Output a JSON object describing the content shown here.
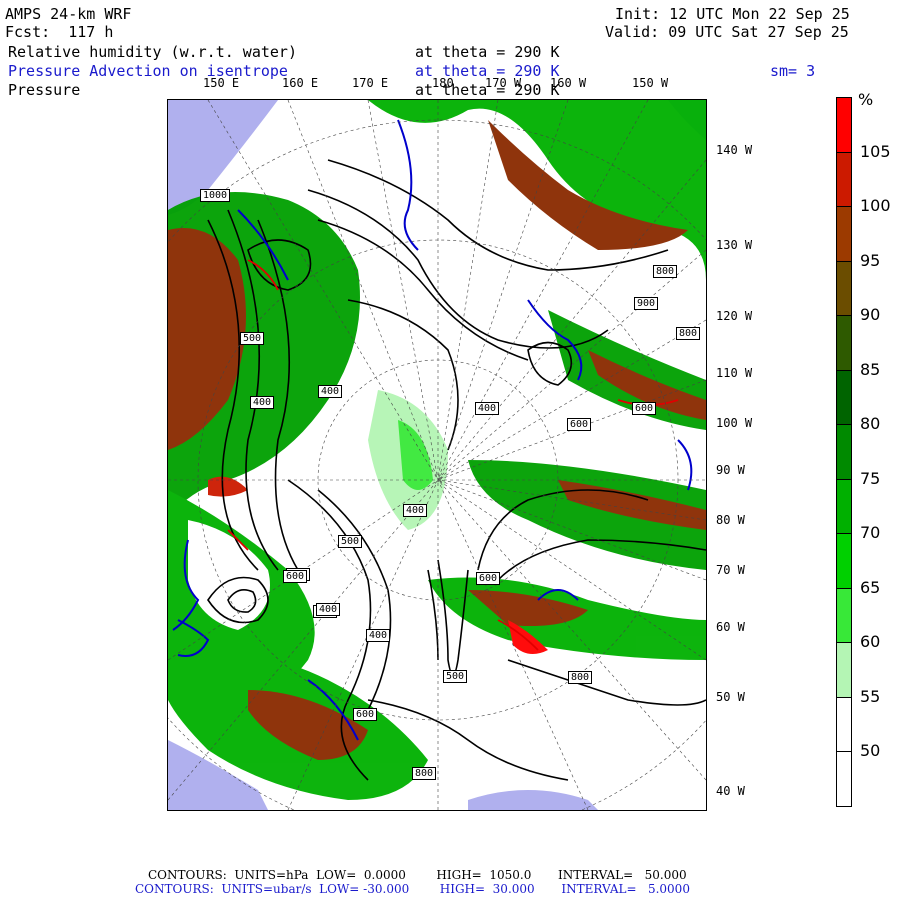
{
  "header": {
    "model": "AMPS 24-km WRF",
    "fcst": "Fcst:  117 h",
    "init": "Init: 12 UTC Mon 22 Sep 25",
    "valid": "Valid: 09 UTC Sat 27 Sep 25",
    "field1": "Relative humidity (w.r.t. water)",
    "field1_level": "at theta = 290 K",
    "field2": "Pressure Advection on isentrope",
    "field2_level": "at theta = 290 K",
    "field2_smooth": "sm= 3",
    "field3": "Pressure",
    "field3_level": "at theta = 290 K"
  },
  "lon_labels_top": [
    "150 E",
    "160 E",
    "170 E",
    "180",
    "170 W",
    "160 W",
    "150 W"
  ],
  "lat_labels_right": [
    "140 W",
    "130 W",
    "120 W",
    "110 W",
    "100 W",
    "90 W",
    "80 W",
    "70 W",
    "60 W",
    "50 W",
    "40 W"
  ],
  "pressure_labels": [
    "1000",
    "500",
    "400",
    "400",
    "400",
    "800",
    "900",
    "800",
    "600",
    "600",
    "500",
    "400",
    "500",
    "600",
    "500",
    "600",
    "400",
    "400",
    "500",
    "800",
    "600",
    "800"
  ],
  "colorbar": {
    "unit": "%",
    "levels": [
      "105",
      "100",
      "95",
      "90",
      "85",
      "80",
      "75",
      "70",
      "65",
      "60",
      "55",
      "50"
    ],
    "colors": [
      "#ff0000",
      "#cc1a00",
      "#9c3a00",
      "#6b4d00",
      "#2e5a00",
      "#006400",
      "#008a00",
      "#00b000",
      "#00d000",
      "#38e838",
      "#b4f5b4",
      "#ffffff",
      "#ffffff"
    ]
  },
  "footer": {
    "line1": "CONTOURS:  UNITS=hPa  LOW=  0.0000        HIGH=  1050.0       INTERVAL=   50.000",
    "line2": "CONTOURS:  UNITS=ubar/s  LOW= -30.000        HIGH=  30.000       INTERVAL=   5.0000"
  }
}
